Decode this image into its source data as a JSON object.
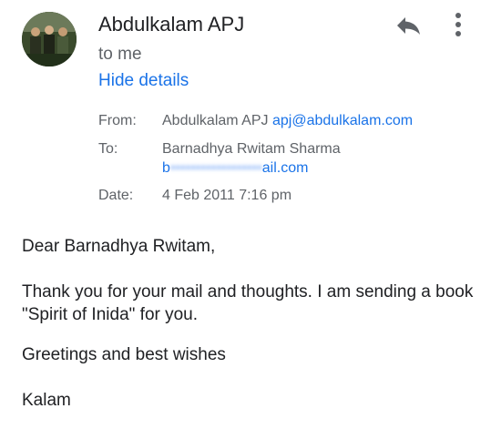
{
  "header": {
    "sender_name": "Abdulkalam APJ",
    "recipient_summary": "to me",
    "toggle_details_label": "Hide details",
    "avatar_icon": "profile-photo",
    "reply_icon": "reply-icon",
    "more_icon": "more-vert-icon"
  },
  "details": {
    "from_label": "From:",
    "from_name": "Abdulkalam APJ",
    "from_email": "apj@abdulkalam.com",
    "to_label": "To:",
    "to_name": "Barnadhya Rwitam Sharma",
    "to_email_visible_prefix": "b",
    "to_email_redacted": "••••••••••••••••••",
    "to_email_visible_suffix": "ail.com",
    "date_label": "Date:",
    "date_value": "4 Feb 2011 7:16 pm"
  },
  "message": {
    "greeting": "Dear Barnadhya Rwitam,",
    "paragraph_1": "Thank you for your mail and thoughts. I am sending a book \"Spirit of Inida\" for you.",
    "paragraph_2": "Greetings and best wishes",
    "signature": "Kalam"
  },
  "colors": {
    "link": "#1a73e8",
    "secondary_text": "#5f6368",
    "primary_text": "#202124",
    "icon": "#5f6368"
  }
}
